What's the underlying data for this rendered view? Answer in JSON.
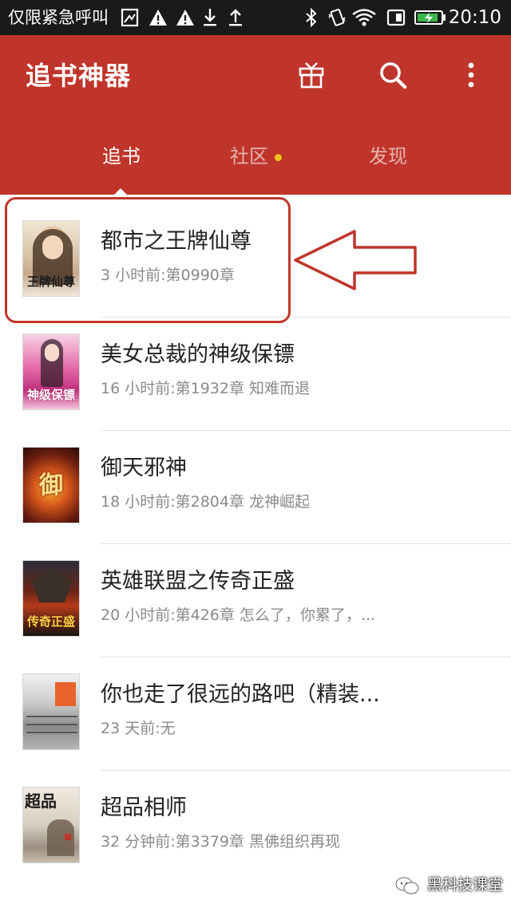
{
  "status_bar": {
    "carrier": "仅限紧急呼叫",
    "time": "20:10",
    "icons": [
      "sim-icon",
      "alert-icon",
      "alert-icon",
      "download-icon",
      "upload-icon",
      "bluetooth-icon",
      "vibrate-icon",
      "wifi-icon",
      "data-saver-icon",
      "battery-charging-icon"
    ]
  },
  "app_bar": {
    "title": "追书神器",
    "actions": [
      "gift-icon",
      "search-icon",
      "more-vert-icon"
    ]
  },
  "tabs": [
    {
      "label": "追书",
      "active": true
    },
    {
      "label": "社区",
      "has_dot": true
    },
    {
      "label": "发现"
    }
  ],
  "books": [
    {
      "title": "都市之王牌仙尊",
      "meta": "3 小时前:第0990章",
      "cover_text": "王牌仙尊"
    },
    {
      "title": "美女总裁的神级保镖",
      "meta": "16 小时前:第1932章   知难而退",
      "cover_text": "神级保镖"
    },
    {
      "title": "御天邪神",
      "meta": "18 小时前:第2804章 龙神崛起",
      "cover_text": "御"
    },
    {
      "title": "英雄联盟之传奇正盛",
      "meta": "20 小时前:第426章 怎么了，你累了，...",
      "cover_text": "传奇正盛"
    },
    {
      "title": "你也走了很远的路吧（精装...",
      "meta": "23 天前:无",
      "cover_text": ""
    },
    {
      "title": "超品相师",
      "meta": "32 分钟前:第3379章 黑佛组织再现",
      "cover_text": "超品"
    }
  ],
  "watermark": "黑科技课堂",
  "colors": {
    "brand": "#c0352b",
    "tab_dot": "#f2c21a",
    "title_text": "#222222",
    "meta_text": "#8a8a8a"
  }
}
